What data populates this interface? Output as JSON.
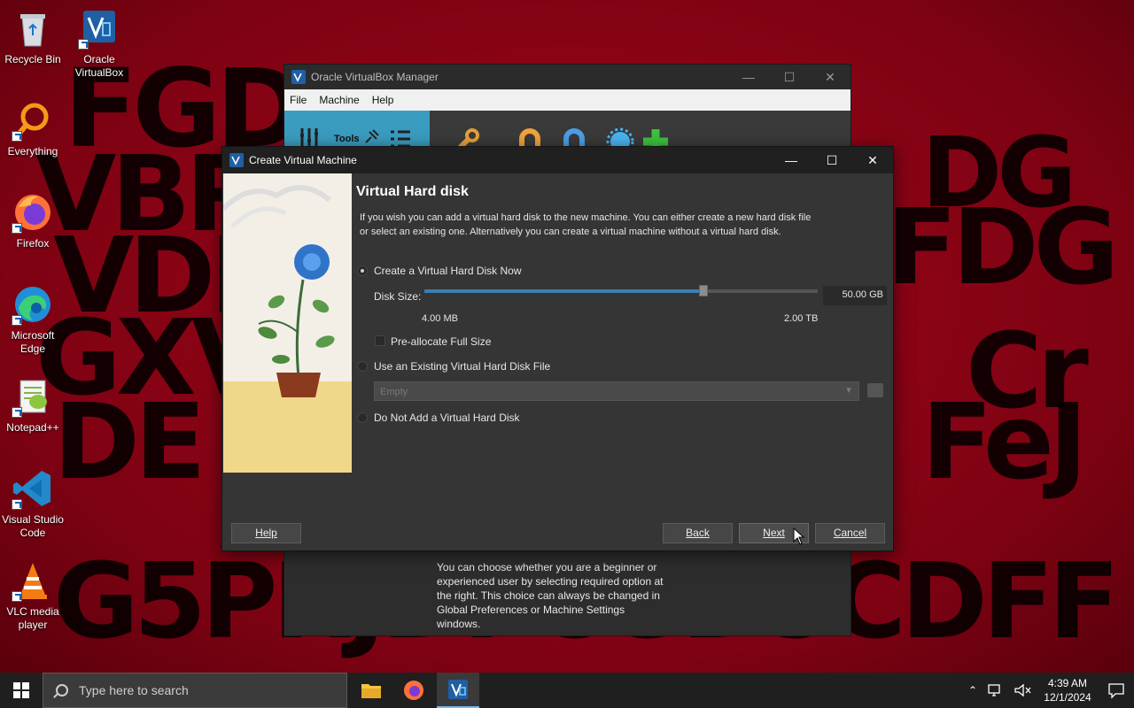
{
  "desktop": {
    "background_text": [
      "FGDCPSTFCK",
      "VBRD",
      "FDG",
      "VDFT",
      "DG",
      "GXVJ",
      "Cr",
      "DE",
      "FeJ",
      "G5PRJDFCGD5CDFF"
    ],
    "icons": [
      {
        "label": "Recycle Bin",
        "icon": "recycle-bin-icon"
      },
      {
        "label": "Oracle VirtualBox",
        "icon": "virtualbox-icon"
      },
      {
        "label": "Everything",
        "icon": "everything-icon"
      },
      {
        "label": "Firefox",
        "icon": "firefox-icon"
      },
      {
        "label": "Microsoft Edge",
        "icon": "edge-icon"
      },
      {
        "label": "Notepad++",
        "icon": "notepadpp-icon"
      },
      {
        "label": "Visual Studio Code",
        "icon": "vscode-icon"
      },
      {
        "label": "VLC media player",
        "icon": "vlc-icon"
      }
    ]
  },
  "manager": {
    "title": "Oracle VirtualBox Manager",
    "menu": [
      "File",
      "Machine",
      "Help"
    ],
    "tools_label": "Tools",
    "description": "You can choose whether you are a beginner or experienced user by selecting required option at the right. This choice can always be changed in Global Preferences or Machine Settings windows."
  },
  "dialog": {
    "title": "Create Virtual Machine",
    "heading": "Virtual Hard disk",
    "intro": "If you wish you can add a virtual hard disk to the new machine. You can either create a new hard disk file or select an existing one. Alternatively you can create a virtual machine without a virtual hard disk.",
    "options": {
      "create_now": "Create a Virtual Hard Disk Now",
      "use_existing": "Use an Existing Virtual Hard Disk File",
      "do_not_add": "Do Not Add a Virtual Hard Disk"
    },
    "selected_option": "create_now",
    "disk_size_label": "Disk Size:",
    "disk_size_value": "50.00 GB",
    "slider_fraction": 0.71,
    "slider_min": "4.00 MB",
    "slider_max": "2.00 TB",
    "preallocate_label": "Pre-allocate Full Size",
    "preallocate_checked": false,
    "existing_combo_value": "Empty",
    "buttons": {
      "help": "Help",
      "back": "Back",
      "next": "Next",
      "cancel": "Cancel"
    }
  },
  "taskbar": {
    "search_placeholder": "Type here to search",
    "time": "4:39 AM",
    "date": "12/1/2024"
  },
  "colors": {
    "accent": "#3d7fb0",
    "tools_bg": "#3a9cc0",
    "desktop_bg": "#8a0010"
  }
}
